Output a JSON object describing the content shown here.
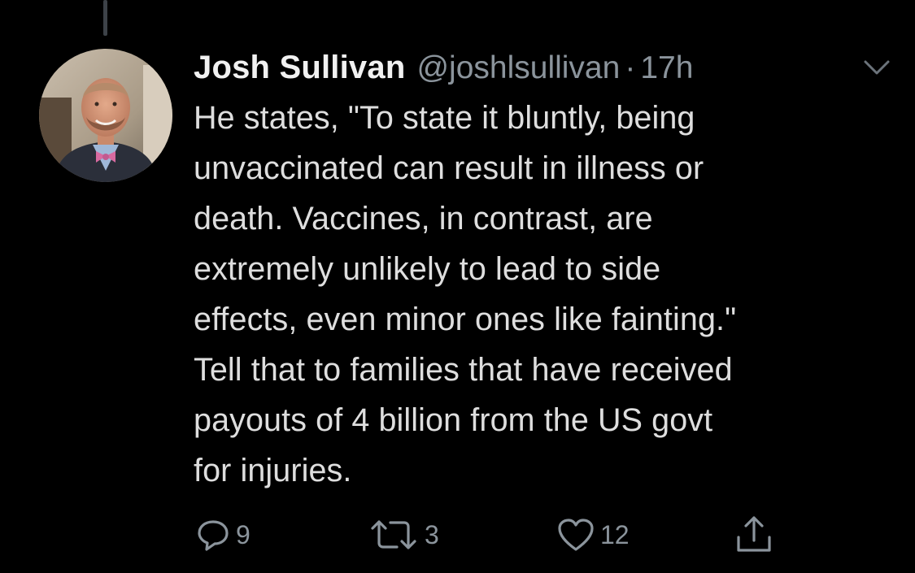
{
  "tweet": {
    "display_name": "Josh Sullivan",
    "handle": "@joshlsullivan",
    "separator": "·",
    "timestamp": "17h",
    "text": "He states, \"To state it bluntly, being\nunvaccinated can result in illness or\ndeath. Vaccines, in contrast, are\nextremely unlikely to lead to side\neffects, even minor ones like fainting.\"\nTell that to families that have received\npayouts of 4 billion from the US govt\nfor injuries."
  },
  "actions": {
    "reply": {
      "icon": "reply-icon",
      "count": "9"
    },
    "retweet": {
      "icon": "retweet-icon",
      "count": "3"
    },
    "like": {
      "icon": "heart-icon",
      "count": "12"
    },
    "share": {
      "icon": "share-icon"
    }
  },
  "colors": {
    "background": "#000000",
    "text": "#dedede",
    "secondary": "#8b949c",
    "thread_line": "#3d4248"
  }
}
